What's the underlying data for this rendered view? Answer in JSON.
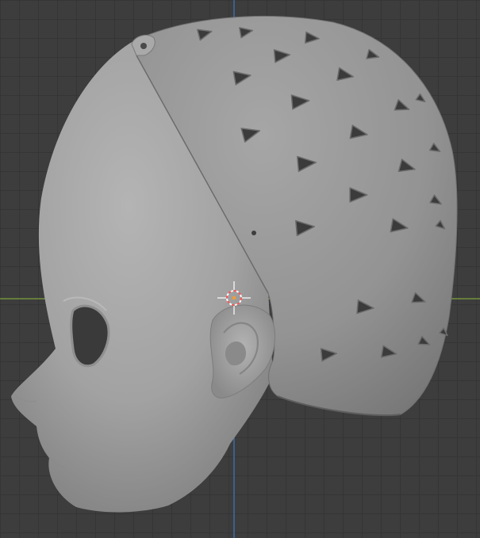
{
  "viewport": {
    "background_color": "#3d3d3d",
    "grid_color": "#353535",
    "x_axis_color": "#7fa33c",
    "z_axis_color": "#3d79c4"
  },
  "objects": [
    {
      "name": "head",
      "kind": "sculpted-mesh",
      "color": "#9c9c9c"
    },
    {
      "name": "ear",
      "kind": "sculpted-mesh",
      "color": "#999999"
    },
    {
      "name": "perforated-skull-cap",
      "kind": "mesh",
      "color": "#939393",
      "vent_shape": "triangle"
    }
  ],
  "cursor": {
    "type": "3d-cursor",
    "colors": [
      "#ff5555",
      "#ffffff"
    ]
  }
}
